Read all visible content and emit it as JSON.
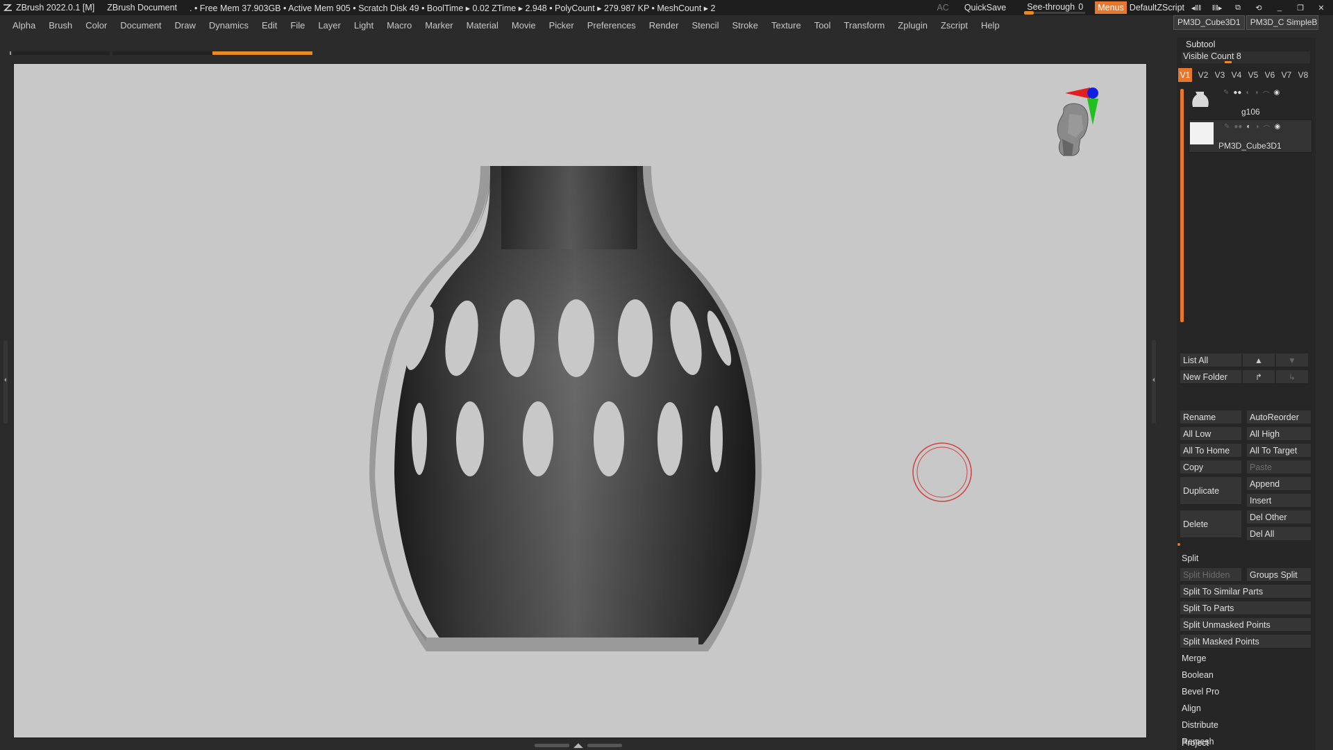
{
  "titlebar": {
    "app_title": "ZBrush 2022.0.1 [M]",
    "doc_title": "ZBrush Document",
    "stats": ". • Free Mem 37.903GB • Active Mem 905 • Scratch Disk 49 • BoolTime ▸ 0.02 ZTime ▸ 2.948 • PolyCount ▸ 279.987 KP • MeshCount ▸ 2",
    "ac_label": "AC",
    "quicksave_label": "QuickSave",
    "seethrough_label": "See-through",
    "seethrough_value": "0",
    "menus_label": "Menus",
    "default_zscript_label": "DefaultZScript"
  },
  "menubar": {
    "items": [
      "Alpha",
      "Brush",
      "Color",
      "Document",
      "Draw",
      "Dynamics",
      "Edit",
      "File",
      "Layer",
      "Light",
      "Macro",
      "Marker",
      "Material",
      "Movie",
      "Picker",
      "Preferences",
      "Render",
      "Stencil",
      "Stroke",
      "Texture",
      "Tool",
      "Transform",
      "Zplugin",
      "Zscript",
      "Help"
    ]
  },
  "panel": {
    "tooltabs": [
      "PM3D_Cube3D1",
      "PM3D_C SimpleB"
    ],
    "subtool_title": "Subtool",
    "visible_count_label": "Visible Count 8",
    "visibility_sets": [
      "V1",
      "V2",
      "V3",
      "V4",
      "V5",
      "V6",
      "V7",
      "V8"
    ],
    "active_set": "V1",
    "subtools": [
      {
        "name": "g106"
      },
      {
        "name": "PM3D_Cube3D1"
      }
    ],
    "buttons": {
      "list_all": "List All",
      "new_folder": "New Folder",
      "rename": "Rename",
      "autoreorder": "AutoReorder",
      "all_low": "All Low",
      "all_high": "All High",
      "all_to_home": "All To Home",
      "all_to_target": "All To Target",
      "copy": "Copy",
      "paste": "Paste",
      "duplicate": "Duplicate",
      "append": "Append",
      "insert": "Insert",
      "delete": "Delete",
      "del_other": "Del Other",
      "del_all": "Del All",
      "split": "Split",
      "split_hidden": "Split Hidden",
      "groups_split": "Groups Split",
      "split_similar": "Split To Similar Parts",
      "split_parts": "Split To Parts",
      "split_unmasked": "Split Unmasked Points",
      "split_masked": "Split Masked Points",
      "merge": "Merge",
      "boolean": "Boolean",
      "bevel_pro": "Bevel Pro",
      "align": "Align",
      "distribute": "Distribute",
      "remesh": "Remesh",
      "project": "Project"
    }
  },
  "colors": {
    "accent": "#e8772e",
    "viewport_bg": "#c8c8c8",
    "ui_bg": "#2b2b2b"
  }
}
